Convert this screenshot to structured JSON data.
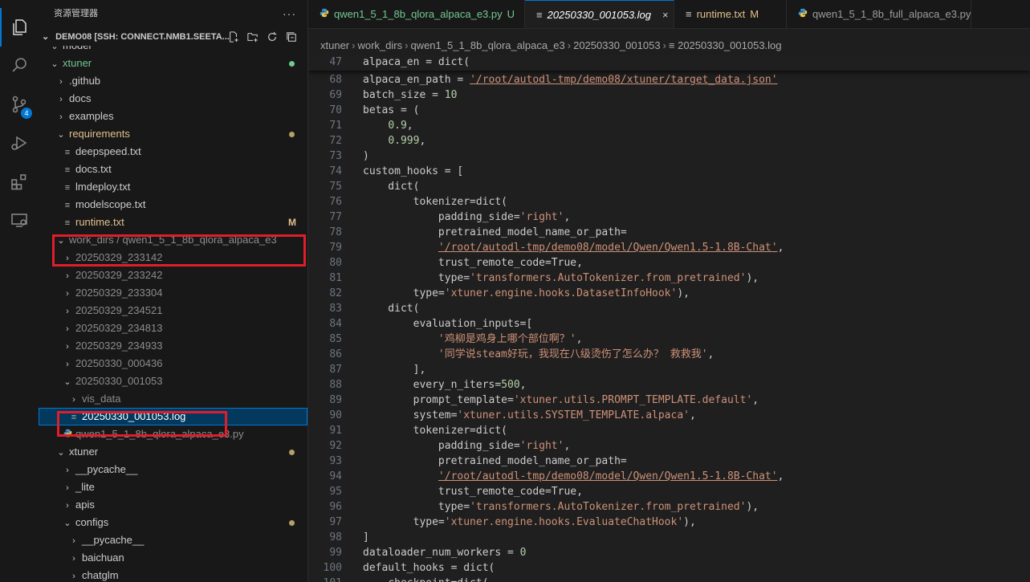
{
  "colors": {
    "accent": "#0078d4",
    "string": "#ce9178",
    "number": "#b5cea8",
    "modified": "#e2c08d",
    "untracked": "#73c991",
    "highlight": "#e01e2b"
  },
  "activity": {
    "scm_badge": "4",
    "icons": [
      "files-icon",
      "search-icon",
      "source-control-icon",
      "run-debug-icon",
      "extensions-icon",
      "remote-explorer-icon"
    ]
  },
  "sidebar": {
    "title": "资源管理器",
    "more": "···",
    "section": "DEMO08 [SSH: CONNECT.NMB1.SEETA...",
    "tree": [
      {
        "label": "model",
        "indent": 1,
        "chev": "⌄",
        "type": "folder"
      },
      {
        "label": "xtuner",
        "indent": 1,
        "chev": "⌄",
        "type": "folder",
        "color": "#73c991",
        "dot": "#73c991"
      },
      {
        "label": ".github",
        "indent": 2,
        "chev": "›",
        "type": "folder"
      },
      {
        "label": "docs",
        "indent": 2,
        "chev": "›",
        "type": "folder"
      },
      {
        "label": "examples",
        "indent": 2,
        "chev": "›",
        "type": "folder"
      },
      {
        "label": "requirements",
        "indent": 2,
        "chev": "⌄",
        "type": "folder",
        "color": "#e2c08d",
        "dot": "#b5a06a"
      },
      {
        "label": "deepspeed.txt",
        "indent": 3,
        "type": "txt"
      },
      {
        "label": "docs.txt",
        "indent": 3,
        "type": "txt"
      },
      {
        "label": "lmdeploy.txt",
        "indent": 3,
        "type": "txt"
      },
      {
        "label": "modelscope.txt",
        "indent": 3,
        "type": "txt"
      },
      {
        "label": "runtime.txt",
        "indent": 3,
        "type": "txt",
        "color": "#e2c08d",
        "mark": "M"
      },
      {
        "label": "work_dirs / qwen1_5_1_8b_qlora_alpaca_e3",
        "indent": 2,
        "chev": "⌄",
        "type": "folder",
        "color": "#8c8c8c"
      },
      {
        "label": "20250329_233142",
        "indent": 3,
        "chev": "›",
        "type": "folder",
        "color": "#8c8c8c"
      },
      {
        "label": "20250329_233242",
        "indent": 3,
        "chev": "›",
        "type": "folder",
        "color": "#8c8c8c"
      },
      {
        "label": "20250329_233304",
        "indent": 3,
        "chev": "›",
        "type": "folder",
        "color": "#8c8c8c"
      },
      {
        "label": "20250329_234521",
        "indent": 3,
        "chev": "›",
        "type": "folder",
        "color": "#8c8c8c"
      },
      {
        "label": "20250329_234813",
        "indent": 3,
        "chev": "›",
        "type": "folder",
        "color": "#8c8c8c"
      },
      {
        "label": "20250329_234933",
        "indent": 3,
        "chev": "›",
        "type": "folder",
        "color": "#8c8c8c"
      },
      {
        "label": "20250330_000436",
        "indent": 3,
        "chev": "›",
        "type": "folder",
        "color": "#8c8c8c"
      },
      {
        "label": "20250330_001053",
        "indent": 3,
        "chev": "⌄",
        "type": "folder",
        "color": "#8c8c8c"
      },
      {
        "label": "vis_data",
        "indent": 4,
        "chev": "›",
        "type": "folder",
        "color": "#8c8c8c"
      },
      {
        "label": "20250330_001053.log",
        "indent": 4,
        "type": "log",
        "color": "#ffffff",
        "selected": true
      },
      {
        "label": "qwen1_5_1_8b_qlora_alpaca_e3.py",
        "indent": 3,
        "type": "py",
        "color": "#8c8c8c"
      },
      {
        "label": "xtuner",
        "indent": 2,
        "chev": "⌄",
        "type": "folder",
        "dot": "#b5a06a"
      },
      {
        "label": "__pycache__",
        "indent": 3,
        "chev": "›",
        "type": "folder"
      },
      {
        "label": "_lite",
        "indent": 3,
        "chev": "›",
        "type": "folder"
      },
      {
        "label": "apis",
        "indent": 3,
        "chev": "›",
        "type": "folder"
      },
      {
        "label": "configs",
        "indent": 3,
        "chev": "⌄",
        "type": "folder",
        "dot": "#b5a06a"
      },
      {
        "label": "__pycache__",
        "indent": 4,
        "chev": "›",
        "type": "folder"
      },
      {
        "label": "baichuan",
        "indent": 4,
        "chev": "›",
        "type": "folder"
      },
      {
        "label": "chatglm",
        "indent": 4,
        "chev": "›",
        "type": "folder"
      }
    ]
  },
  "tabs": [
    {
      "label": "qwen1_5_1_8b_qlora_alpaca_e3.py",
      "suffix": "U",
      "icon": "python-icon",
      "active": false
    },
    {
      "label": "20250330_001053.log",
      "suffix": "",
      "icon": "log-icon",
      "active": true,
      "italic": true,
      "close": "×"
    },
    {
      "label": "runtime.txt",
      "suffix": "M",
      "icon": "txt-icon",
      "active": false
    },
    {
      "label": "qwen1_5_1_8b_full_alpaca_e3.py",
      "suffix": "",
      "icon": "python-icon",
      "active": false
    }
  ],
  "breadcrumb": [
    "xtuner",
    "work_dirs",
    "qwen1_5_1_8b_qlora_alpaca_e3",
    "20250330_001053",
    "20250330_001053.log"
  ],
  "code": {
    "sticky": {
      "num": "47",
      "text": "alpaca_en = dict("
    },
    "lines": [
      {
        "num": "68",
        "parts": [
          [
            "c",
            "alpaca_en_path = "
          ],
          [
            "su",
            "'/root/autodl-tmp/demo08/xtuner/target_data.json'"
          ]
        ]
      },
      {
        "num": "69",
        "parts": [
          [
            "c",
            "batch_size = "
          ],
          [
            "n",
            "10"
          ]
        ]
      },
      {
        "num": "70",
        "parts": [
          [
            "c",
            "betas = ("
          ]
        ]
      },
      {
        "num": "71",
        "parts": [
          [
            "c",
            "    "
          ],
          [
            "n",
            "0.9"
          ],
          [
            "c",
            ","
          ]
        ]
      },
      {
        "num": "72",
        "parts": [
          [
            "c",
            "    "
          ],
          [
            "n",
            "0.999"
          ],
          [
            "c",
            ","
          ]
        ]
      },
      {
        "num": "73",
        "parts": [
          [
            "c",
            ")"
          ]
        ]
      },
      {
        "num": "74",
        "parts": [
          [
            "c",
            "custom_hooks = ["
          ]
        ]
      },
      {
        "num": "75",
        "parts": [
          [
            "c",
            "    dict("
          ]
        ]
      },
      {
        "num": "76",
        "parts": [
          [
            "c",
            "        tokenizer=dict("
          ]
        ]
      },
      {
        "num": "77",
        "parts": [
          [
            "c",
            "            padding_side="
          ],
          [
            "s",
            "'right'"
          ],
          [
            "c",
            ","
          ]
        ]
      },
      {
        "num": "78",
        "parts": [
          [
            "c",
            "            pretrained_model_name_or_path="
          ]
        ]
      },
      {
        "num": "79",
        "parts": [
          [
            "c",
            "            "
          ],
          [
            "su",
            "'/root/autodl-tmp/demo08/model/Qwen/Qwen1.5-1.8B-Chat'"
          ],
          [
            "c",
            ","
          ]
        ]
      },
      {
        "num": "80",
        "parts": [
          [
            "c",
            "            trust_remote_code=True,"
          ]
        ]
      },
      {
        "num": "81",
        "parts": [
          [
            "c",
            "            type="
          ],
          [
            "s",
            "'transformers.AutoTokenizer.from_pretrained'"
          ],
          [
            "c",
            "),"
          ]
        ]
      },
      {
        "num": "82",
        "parts": [
          [
            "c",
            "        type="
          ],
          [
            "s",
            "'xtuner.engine.hooks.DatasetInfoHook'"
          ],
          [
            "c",
            "),"
          ]
        ]
      },
      {
        "num": "83",
        "parts": [
          [
            "c",
            "    dict("
          ]
        ]
      },
      {
        "num": "84",
        "parts": [
          [
            "c",
            "        evaluation_inputs=["
          ]
        ]
      },
      {
        "num": "85",
        "parts": [
          [
            "c",
            "            "
          ],
          [
            "s",
            "'鸡柳是鸡身上哪个部位啊？'"
          ],
          [
            "c",
            ","
          ]
        ]
      },
      {
        "num": "86",
        "parts": [
          [
            "c",
            "            "
          ],
          [
            "s",
            "'同学说steam好玩，我现在八级烫伤了怎么办？ 救救我'"
          ],
          [
            "c",
            ","
          ]
        ]
      },
      {
        "num": "87",
        "parts": [
          [
            "c",
            "        ],"
          ]
        ]
      },
      {
        "num": "88",
        "parts": [
          [
            "c",
            "        every_n_iters="
          ],
          [
            "n",
            "500"
          ],
          [
            "c",
            ","
          ]
        ]
      },
      {
        "num": "89",
        "parts": [
          [
            "c",
            "        prompt_template="
          ],
          [
            "s",
            "'xtuner.utils.PROMPT_TEMPLATE.default'"
          ],
          [
            "c",
            ","
          ]
        ]
      },
      {
        "num": "90",
        "parts": [
          [
            "c",
            "        system="
          ],
          [
            "s",
            "'xtuner.utils.SYSTEM_TEMPLATE.alpaca'"
          ],
          [
            "c",
            ","
          ]
        ]
      },
      {
        "num": "91",
        "parts": [
          [
            "c",
            "        tokenizer=dict("
          ]
        ]
      },
      {
        "num": "92",
        "parts": [
          [
            "c",
            "            padding_side="
          ],
          [
            "s",
            "'right'"
          ],
          [
            "c",
            ","
          ]
        ]
      },
      {
        "num": "93",
        "parts": [
          [
            "c",
            "            pretrained_model_name_or_path="
          ]
        ]
      },
      {
        "num": "94",
        "parts": [
          [
            "c",
            "            "
          ],
          [
            "su",
            "'/root/autodl-tmp/demo08/model/Qwen/Qwen1.5-1.8B-Chat'"
          ],
          [
            "c",
            ","
          ]
        ]
      },
      {
        "num": "95",
        "parts": [
          [
            "c",
            "            trust_remote_code=True,"
          ]
        ]
      },
      {
        "num": "96",
        "parts": [
          [
            "c",
            "            type="
          ],
          [
            "s",
            "'transformers.AutoTokenizer.from_pretrained'"
          ],
          [
            "c",
            "),"
          ]
        ]
      },
      {
        "num": "97",
        "parts": [
          [
            "c",
            "        type="
          ],
          [
            "s",
            "'xtuner.engine.hooks.EvaluateChatHook'"
          ],
          [
            "c",
            "),"
          ]
        ]
      },
      {
        "num": "98",
        "parts": [
          [
            "c",
            "]"
          ]
        ]
      },
      {
        "num": "99",
        "parts": [
          [
            "c",
            "dataloader_num_workers = "
          ],
          [
            "n",
            "0"
          ]
        ]
      },
      {
        "num": "100",
        "parts": [
          [
            "c",
            "default_hooks = dict("
          ]
        ]
      },
      {
        "num": "101",
        "parts": [
          [
            "c",
            "    checkpoint=dict("
          ]
        ]
      }
    ]
  }
}
